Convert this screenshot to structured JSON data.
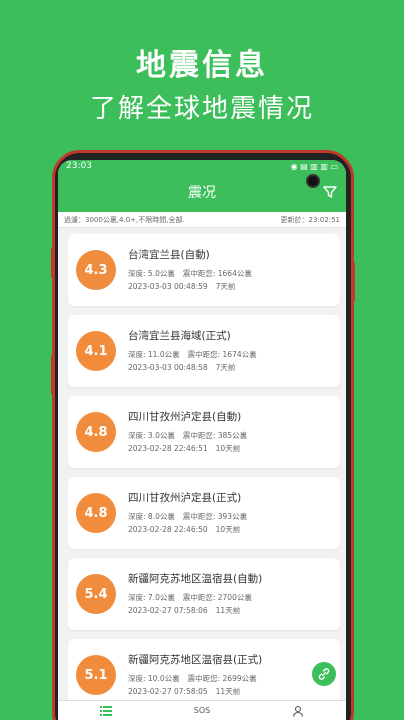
{
  "promo": {
    "title": "地震信息",
    "subtitle": "了解全球地震情况"
  },
  "status_bar": {
    "time": "23:03",
    "icons": "◉ ▤ ▥ ▥ ▭"
  },
  "app_bar": {
    "title": "震况"
  },
  "filter": {
    "summary": "過濾：3000公裏,4.0+,不限時間,全部.",
    "updated": "更新於：23:02:51"
  },
  "colors": {
    "brand_green": "#3cbf5b",
    "magnitude_orange": "#f08c3c"
  },
  "quakes": [
    {
      "magnitude": "4.3",
      "location": "台湾宜兰县(自動)",
      "depth": "深度: 5.0公裏",
      "distance": "震中距您: 1664公裏",
      "time": "2023-03-03 00:48:59",
      "ago": "7天前"
    },
    {
      "magnitude": "4.1",
      "location": "台湾宜兰县海域(正式)",
      "depth": "深度: 11.0公裏",
      "distance": "震中距您: 1674公裏",
      "time": "2023-03-03 00:48:58",
      "ago": "7天前"
    },
    {
      "magnitude": "4.8",
      "location": "四川甘孜州泸定县(自動)",
      "depth": "深度: 3.0公裏",
      "distance": "震中距您: 385公裏",
      "time": "2023-02-28 22:46:51",
      "ago": "10天前"
    },
    {
      "magnitude": "4.8",
      "location": "四川甘孜州泸定县(正式)",
      "depth": "深度: 8.0公裏",
      "distance": "震中距您: 393公裏",
      "time": "2023-02-28 22:46:50",
      "ago": "10天前"
    },
    {
      "magnitude": "5.4",
      "location": "新疆阿克苏地区温宿县(自動)",
      "depth": "深度: 7.0公裏",
      "distance": "震中距您: 2700公裏",
      "time": "2023-02-27 07:58:06",
      "ago": "11天前"
    },
    {
      "magnitude": "5.1",
      "location": "新疆阿克苏地区温宿县(正式)",
      "depth": "深度: 10.0公裏",
      "distance": "震中距您: 2699公裏",
      "time": "2023-02-27 07:58:05",
      "ago": "11天前"
    }
  ],
  "bottom_nav": {
    "list_icon": "list-icon",
    "sos_label": "SOS",
    "profile_icon": "person-icon"
  },
  "fab_icon": "link-icon"
}
